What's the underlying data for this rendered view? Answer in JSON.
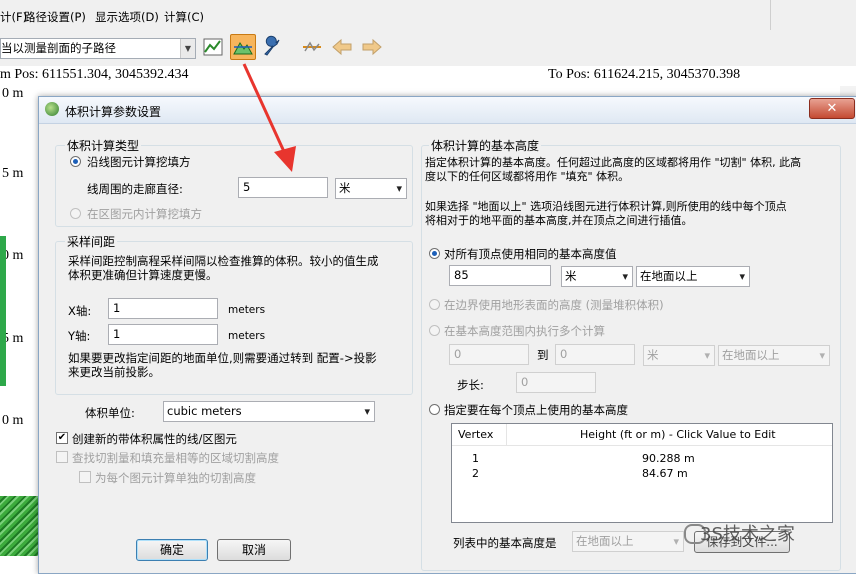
{
  "app": {
    "menu": [
      "计(F)",
      "路径设置(P)",
      "显示选项(D)",
      "计算(C)"
    ],
    "path_combo": "当以测量剖面的子路径",
    "from_pos": "m Pos: 611551.304, 3045392.434",
    "to_pos": "To Pos: 611624.215, 3045370.398",
    "y_ticks": [
      "0 m",
      "5 m",
      "0 m",
      "5 m",
      "0 m"
    ],
    "toolbar_icons": [
      "profile-graph-icon",
      "terrain-icon",
      "wrench-icon",
      "line-tool-icon",
      "arrow-left-icon",
      "arrow-right-icon"
    ]
  },
  "dialog": {
    "title": "体积计算参数设置",
    "close": "✕",
    "calc_type": {
      "title": "体积计算类型",
      "opt_line": "沿线图元计算挖填方",
      "corridor_label": "线周围的走廊直径:",
      "corridor_value": "5",
      "corridor_unit": "米",
      "opt_area": "在区图元内计算挖填方"
    },
    "sampling": {
      "title": "采样间距",
      "desc1": "采样间距控制高程采样间隔以检查推算的体积。较小的值生成",
      "desc2": "体积更准确但计算速度更慢。",
      "x_label": "X轴:",
      "x_value": "1",
      "x_unit": "meters",
      "y_label": "Y轴:",
      "y_value": "1",
      "y_unit": "meters",
      "note1": "如果要更改指定间距的地面单位,则需要通过转到 配置->投影",
      "note2": "来更改当前投影。"
    },
    "volume_unit_label": "体积单位:",
    "volume_unit_value": "cubic meters",
    "chk_create": "创建新的带体积属性的线/区图元",
    "chk_find": "查找切割量和填充量相等的区域切割高度",
    "chk_each": "为每个图元计算单独的切割高度",
    "ok": "确定",
    "cancel": "取消",
    "base": {
      "title": "体积计算的基本高度",
      "desc1": "指定体积计算的基本高度。任何超过此高度的区域都将用作 \"切割\" 体积, 此高",
      "desc2": "度以下的任何区域都将用作 \"填充\" 体积。",
      "desc3": "如果选择 \"地面以上\" 选项沿线图元进行体积计算,则所使用的线中每个顶点",
      "desc4": "将相对于的地平面的基本高度,并在顶点之间进行插值。",
      "opt_same": "对所有顶点使用相同的基本高度值",
      "same_value": "85",
      "same_unit": "米",
      "same_ref": "在地面以上",
      "opt_border": "在边界使用地形表面的高度 (测量堆积体积)",
      "opt_range": "在基本高度范围内执行多个计算",
      "range_from": "0",
      "range_to_label": "到",
      "range_to": "0",
      "range_unit": "米",
      "range_ref": "在地面以上",
      "step_label": "步长:",
      "step_value": "0",
      "opt_each": "指定要在每个顶点上使用的基本高度",
      "table_headers": [
        "Vertex",
        "Height (ft or m) - Click Value to Edit"
      ],
      "table_rows": [
        [
          "1",
          "90.288 m"
        ],
        [
          "2",
          "84.67 m"
        ]
      ],
      "list_label": "列表中的基本高度是",
      "list_ref": "在地面以上",
      "save_btn": "保存到文件..."
    }
  },
  "watermark": "3S技术之家",
  "colors": {
    "accent": "#1c5fb8",
    "arrow": "#e8352e",
    "toolbar_active": "#f7b55c"
  }
}
